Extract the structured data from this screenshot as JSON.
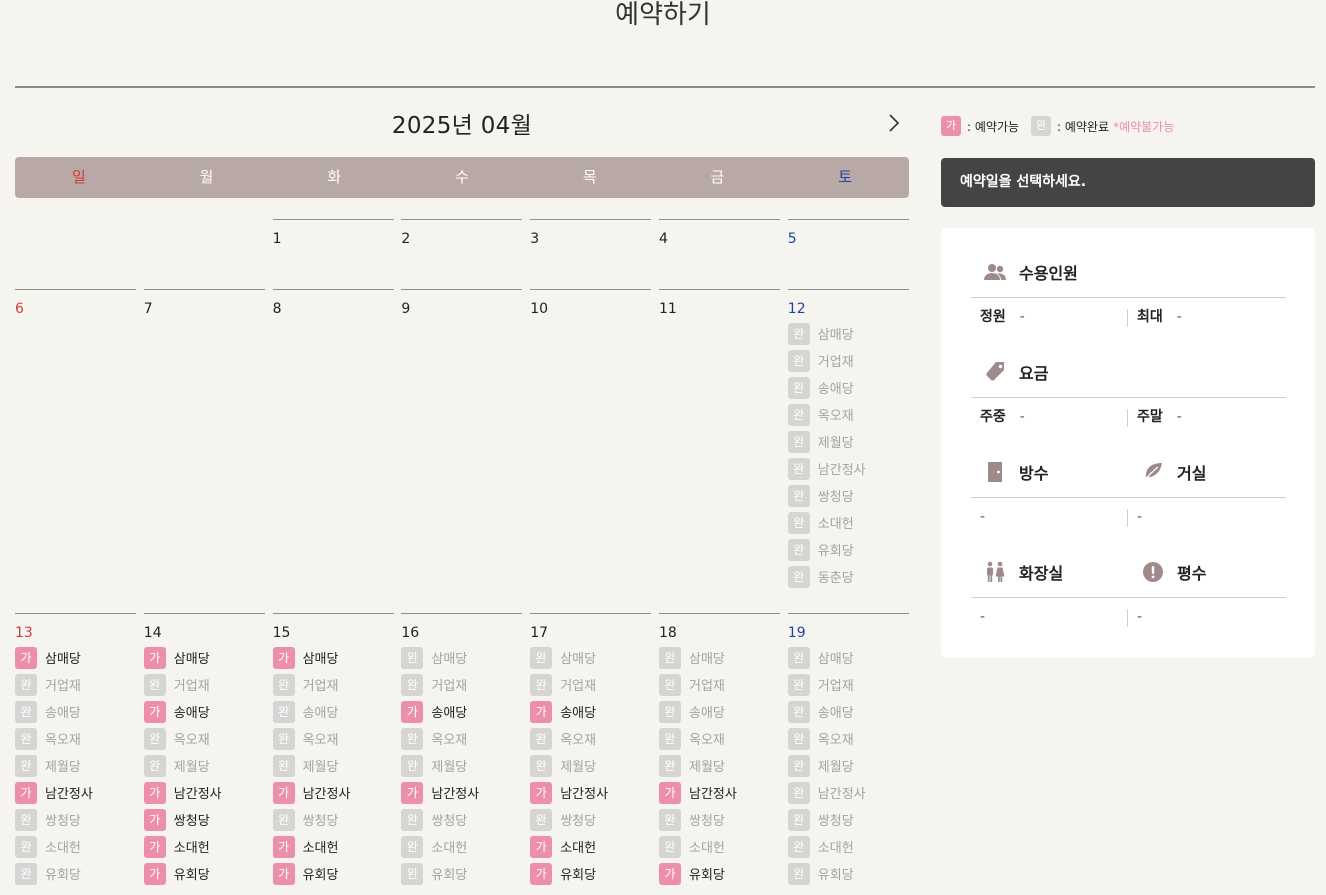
{
  "page": {
    "title": "예약하기"
  },
  "calendar": {
    "month_label": "2025년 04월",
    "weekdays": [
      "일",
      "월",
      "화",
      "수",
      "목",
      "금",
      "토"
    ],
    "legend": {
      "avail_badge": "가",
      "avail_text": ": 예약가능",
      "done_badge": "완",
      "done_text": ": 예약완료",
      "warn_text": "*예약불가능"
    },
    "weeks": [
      [
        {
          "day": "",
          "slots": []
        },
        {
          "day": "",
          "slots": []
        },
        {
          "day": "1",
          "slots": []
        },
        {
          "day": "2",
          "slots": []
        },
        {
          "day": "3",
          "slots": []
        },
        {
          "day": "4",
          "slots": []
        },
        {
          "day": "5",
          "slots": []
        }
      ],
      [
        {
          "day": "6",
          "slots": []
        },
        {
          "day": "7",
          "slots": []
        },
        {
          "day": "8",
          "slots": []
        },
        {
          "day": "9",
          "slots": []
        },
        {
          "day": "10",
          "slots": []
        },
        {
          "day": "11",
          "slots": []
        },
        {
          "day": "12",
          "slots": [
            {
              "status": "done",
              "name": "삼매당"
            },
            {
              "status": "done",
              "name": "거업재"
            },
            {
              "status": "done",
              "name": "송애당"
            },
            {
              "status": "done",
              "name": "옥오재"
            },
            {
              "status": "done",
              "name": "제월당"
            },
            {
              "status": "done",
              "name": "남간정사"
            },
            {
              "status": "done",
              "name": "쌍청당"
            },
            {
              "status": "done",
              "name": "소대헌"
            },
            {
              "status": "done",
              "name": "유회당"
            },
            {
              "status": "done",
              "name": "동춘당"
            }
          ]
        }
      ],
      [
        {
          "day": "13",
          "slots": [
            {
              "status": "avail",
              "name": "삼매당"
            },
            {
              "status": "done",
              "name": "거업재"
            },
            {
              "status": "done",
              "name": "송애당"
            },
            {
              "status": "done",
              "name": "옥오재"
            },
            {
              "status": "done",
              "name": "제월당"
            },
            {
              "status": "avail",
              "name": "남간정사"
            },
            {
              "status": "done",
              "name": "쌍청당"
            },
            {
              "status": "done",
              "name": "소대헌"
            },
            {
              "status": "done",
              "name": "유회당"
            }
          ]
        },
        {
          "day": "14",
          "slots": [
            {
              "status": "avail",
              "name": "삼매당"
            },
            {
              "status": "done",
              "name": "거업재"
            },
            {
              "status": "avail",
              "name": "송애당"
            },
            {
              "status": "done",
              "name": "옥오재"
            },
            {
              "status": "done",
              "name": "제월당"
            },
            {
              "status": "avail",
              "name": "남간정사"
            },
            {
              "status": "avail",
              "name": "쌍청당"
            },
            {
              "status": "avail",
              "name": "소대헌"
            },
            {
              "status": "avail",
              "name": "유회당"
            }
          ]
        },
        {
          "day": "15",
          "slots": [
            {
              "status": "avail",
              "name": "삼매당"
            },
            {
              "status": "done",
              "name": "거업재"
            },
            {
              "status": "done",
              "name": "송애당"
            },
            {
              "status": "done",
              "name": "옥오재"
            },
            {
              "status": "done",
              "name": "제월당"
            },
            {
              "status": "avail",
              "name": "남간정사"
            },
            {
              "status": "done",
              "name": "쌍청당"
            },
            {
              "status": "avail",
              "name": "소대헌"
            },
            {
              "status": "avail",
              "name": "유회당"
            }
          ]
        },
        {
          "day": "16",
          "slots": [
            {
              "status": "done",
              "name": "삼매당"
            },
            {
              "status": "done",
              "name": "거업재"
            },
            {
              "status": "avail",
              "name": "송애당"
            },
            {
              "status": "done",
              "name": "옥오재"
            },
            {
              "status": "done",
              "name": "제월당"
            },
            {
              "status": "avail",
              "name": "남간정사"
            },
            {
              "status": "done",
              "name": "쌍청당"
            },
            {
              "status": "done",
              "name": "소대헌"
            },
            {
              "status": "done",
              "name": "유회당"
            }
          ]
        },
        {
          "day": "17",
          "slots": [
            {
              "status": "done",
              "name": "삼매당"
            },
            {
              "status": "done",
              "name": "거업재"
            },
            {
              "status": "avail",
              "name": "송애당"
            },
            {
              "status": "done",
              "name": "옥오재"
            },
            {
              "status": "done",
              "name": "제월당"
            },
            {
              "status": "avail",
              "name": "남간정사"
            },
            {
              "status": "done",
              "name": "쌍청당"
            },
            {
              "status": "avail",
              "name": "소대헌"
            },
            {
              "status": "avail",
              "name": "유회당"
            }
          ]
        },
        {
          "day": "18",
          "slots": [
            {
              "status": "done",
              "name": "삼매당"
            },
            {
              "status": "done",
              "name": "거업재"
            },
            {
              "status": "done",
              "name": "송애당"
            },
            {
              "status": "done",
              "name": "옥오재"
            },
            {
              "status": "done",
              "name": "제월당"
            },
            {
              "status": "avail",
              "name": "남간정사"
            },
            {
              "status": "done",
              "name": "쌍청당"
            },
            {
              "status": "done",
              "name": "소대헌"
            },
            {
              "status": "avail",
              "name": "유회당"
            }
          ]
        },
        {
          "day": "19",
          "slots": [
            {
              "status": "done",
              "name": "삼매당"
            },
            {
              "status": "done",
              "name": "거업재"
            },
            {
              "status": "done",
              "name": "송애당"
            },
            {
              "status": "done",
              "name": "옥오재"
            },
            {
              "status": "done",
              "name": "제월당"
            },
            {
              "status": "done",
              "name": "남간정사"
            },
            {
              "status": "done",
              "name": "쌍청당"
            },
            {
              "status": "done",
              "name": "소대헌"
            },
            {
              "status": "done",
              "name": "유회당"
            }
          ]
        }
      ]
    ]
  },
  "panel": {
    "select_prompt": "예약일을 선택하세요.",
    "capacity": {
      "title": "수용인원",
      "k1": "정원",
      "v1": "-",
      "k2": "최대",
      "v2": "-"
    },
    "fee": {
      "title": "요금",
      "k1": "주중",
      "v1": "-",
      "k2": "주말",
      "v2": "-"
    },
    "rooms": {
      "title": "방수",
      "value": "-"
    },
    "living": {
      "title": "거실",
      "value": "-"
    },
    "toilet": {
      "title": "화장실",
      "value": "-"
    },
    "area": {
      "title": "평수",
      "value": "-"
    }
  },
  "colors": {
    "accent_pink": "#ec8fa9",
    "done_gray": "#d6d5d3",
    "weekday_bar": "#b8a9a6",
    "sunday": "#d33b3b",
    "saturday": "#1e44a4"
  }
}
